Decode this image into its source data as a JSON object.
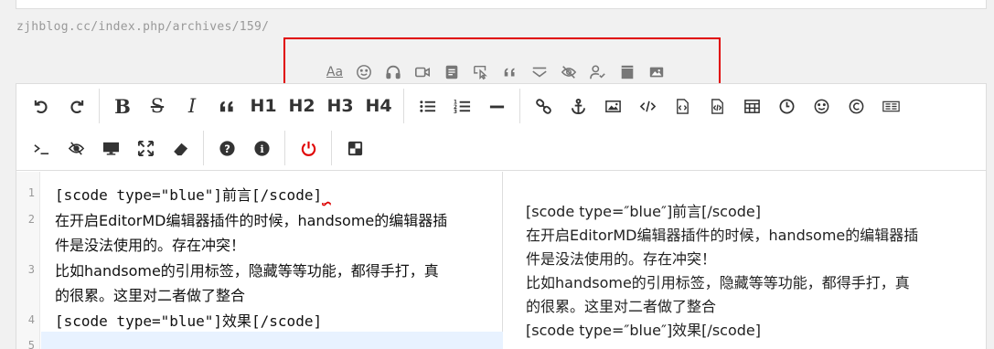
{
  "url": "zjhblog.cc/index.php/archives/159/",
  "shortcode_toolbar": {
    "items": [
      {
        "name": "font",
        "label": "Aa"
      },
      {
        "name": "smile-icon"
      },
      {
        "name": "headphones-icon"
      },
      {
        "name": "video-icon"
      },
      {
        "name": "document-icon"
      },
      {
        "name": "click-icon"
      },
      {
        "name": "quote-icon"
      },
      {
        "name": "collapse-icon"
      },
      {
        "name": "hide-icon"
      },
      {
        "name": "user-check-icon"
      },
      {
        "name": "album-icon"
      },
      {
        "name": "image-icon"
      }
    ]
  },
  "toolbar": {
    "row1": [
      "undo",
      "redo",
      "|",
      "bold",
      "strikethrough",
      "italic",
      "quote",
      "H1",
      "H2",
      "H3",
      "H4",
      "|",
      "list-ul",
      "list-ol",
      "hr",
      "|",
      "link",
      "anchor",
      "image",
      "code",
      "code-block",
      "preformatted",
      "table",
      "datetime",
      "emoji",
      "html-entities",
      "pagebreak"
    ],
    "row2": [
      "watch",
      "preview",
      "fullscreen",
      "clear",
      "|",
      "help",
      "info",
      "|",
      "power",
      "|",
      "theme"
    ],
    "labels": {
      "h1": "H1",
      "h2": "H2",
      "h3": "H3",
      "h4": "H4",
      "bold": "B",
      "strike": "S",
      "italic": "I"
    }
  },
  "editor": {
    "line_numbers": [
      "1",
      "2",
      "3",
      "4",
      "5"
    ],
    "lines": [
      "[scode type=\"blue\"]前言[/scode]",
      "在开启EditorMD编辑器插件的时候，handsome的编辑器插",
      "件是没法使用的。存在冲突！",
      "比如handsome的引用标签，隐藏等等功能，都得手打，真",
      "的很累。这里对二者做了整合",
      "[scode type=\"blue\"]效果[/scode]"
    ]
  },
  "preview": {
    "lines": [
      "[scode type=″blue″]前言[/scode]",
      "在开启EditorMD编辑器插件的时候，handsome的编辑器插",
      "件是没法使用的。存在冲突！",
      "比如handsome的引用标签，隐藏等等功能，都得手打，真",
      "的很累。这里对二者做了整合",
      "[scode type=″blue″]效果[/scode]"
    ]
  },
  "colors": {
    "highlight_box": "#e00000",
    "power": "#e00000",
    "active_line": "#e8f2ff"
  }
}
